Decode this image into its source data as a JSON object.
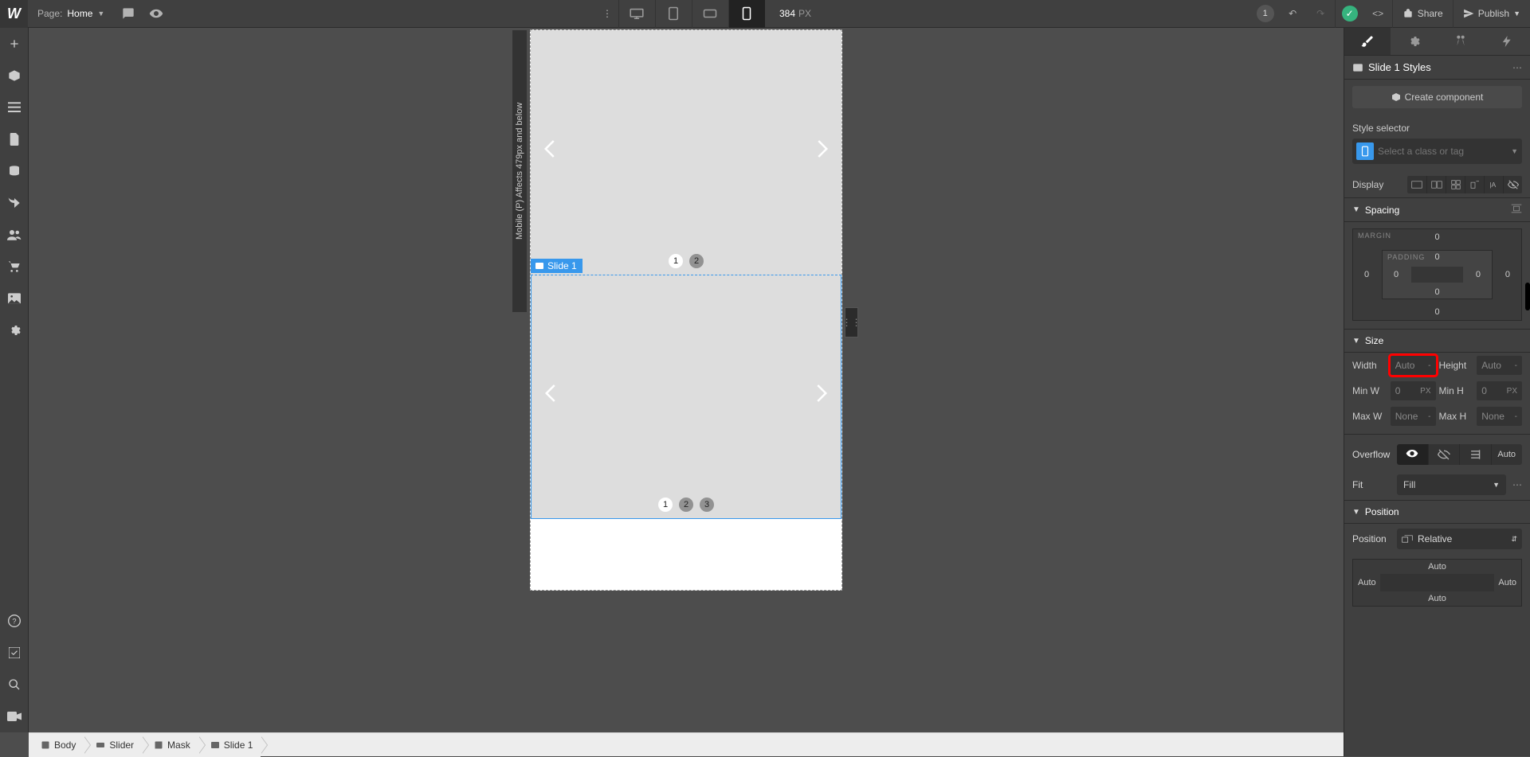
{
  "topbar": {
    "page_label": "Page:",
    "page_name": "Home",
    "viewport_px": "384",
    "viewport_unit": "PX",
    "changes_count": "1",
    "share": "Share",
    "publish": "Publish"
  },
  "canvas": {
    "mobile_label": "Mobile (P)   Affects 479px and below",
    "slider1_dots": [
      "1",
      "2"
    ],
    "slider2_dots": [
      "1",
      "2",
      "3"
    ],
    "selected_tag": "Slide 1"
  },
  "breadcrumb": {
    "body": "Body",
    "slider": "Slider",
    "mask": "Mask",
    "slide": "Slide 1"
  },
  "panel": {
    "header_title": "Slide 1 Styles",
    "create_component": "Create component",
    "style_selector_label": "Style selector",
    "style_placeholder": "Select a class or tag",
    "display_label": "Display",
    "spacing_label": "Spacing",
    "margin_label": "MARGIN",
    "padding_label": "PADDING",
    "spacing_vals": {
      "mt": "0",
      "mr": "0",
      "mb": "0",
      "ml": "0",
      "pt": "0",
      "pr": "0",
      "pb": "0",
      "pl": "0"
    },
    "size_label": "Size",
    "width_label": "Width",
    "width_val": "Auto",
    "height_label": "Height",
    "height_val": "Auto",
    "minw_label": "Min W",
    "minw_val": "0",
    "minw_unit": "PX",
    "minh_label": "Min H",
    "minh_val": "0",
    "minh_unit": "PX",
    "maxw_label": "Max W",
    "maxw_val": "None",
    "maxh_label": "Max H",
    "maxh_val": "None",
    "overflow_label": "Overflow",
    "overflow_auto": "Auto",
    "fit_label": "Fit",
    "fit_val": "Fill",
    "position_section": "Position",
    "position_label": "Position",
    "position_val": "Relative",
    "pos_auto": "Auto"
  }
}
